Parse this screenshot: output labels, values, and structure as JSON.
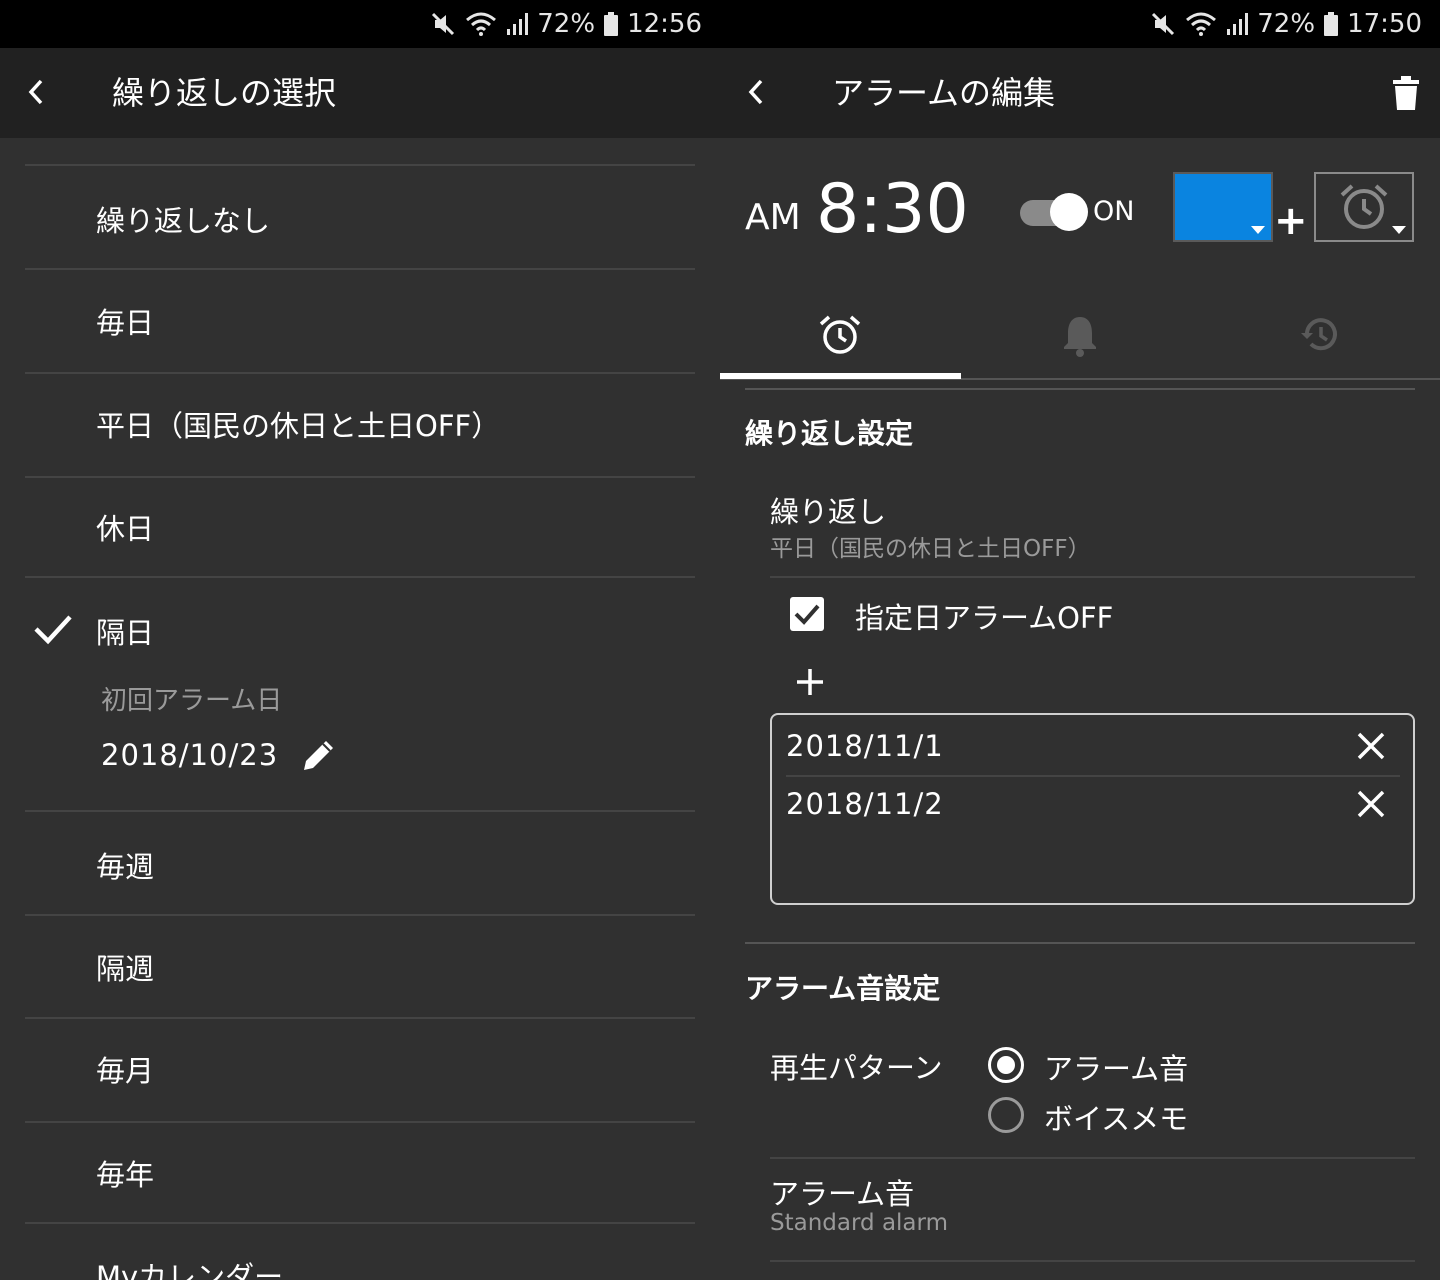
{
  "left": {
    "status": {
      "battery": "72%",
      "time": "12:56"
    },
    "header": {
      "title": "繰り返しの選択"
    },
    "options": [
      {
        "label": "繰り返しなし"
      },
      {
        "label": "毎日"
      },
      {
        "label": "平日（国民の休日と土日OFF）"
      },
      {
        "label": "休日"
      },
      {
        "label": "隔日",
        "selected": true
      },
      {
        "label": "毎週"
      },
      {
        "label": "隔週"
      },
      {
        "label": "毎月"
      },
      {
        "label": "毎年"
      },
      {
        "label": "Myカレンダー"
      }
    ],
    "first_alarm": {
      "label": "初回アラーム日",
      "date": "2018/10/23"
    }
  },
  "right": {
    "status": {
      "battery": "72%",
      "time": "17:50"
    },
    "header": {
      "title": "アラームの編集"
    },
    "alarm": {
      "ampm": "AM",
      "time": "8:30",
      "toggle_label": "ON",
      "toggle_on": true,
      "color": "#0a84e0",
      "plus": "+"
    },
    "tabs": [
      {
        "icon": "alarm-clock-icon",
        "selected": true
      },
      {
        "icon": "bell-icon"
      },
      {
        "icon": "history-icon"
      }
    ],
    "repeat_section": {
      "title": "繰り返し設定",
      "repeat_label": "繰り返し",
      "repeat_value": "平日（国民の休日と土日OFF）",
      "exclude_checkbox_label": "指定日アラームOFF",
      "exclude_checked": true,
      "dates": [
        "2018/11/1",
        "2018/11/2"
      ]
    },
    "sound_section": {
      "title": "アラーム音設定",
      "pattern_label": "再生パターン",
      "pattern_options": [
        {
          "label": "アラーム音",
          "selected": true
        },
        {
          "label": "ボイスメモ",
          "selected": false
        }
      ],
      "sound_label": "アラーム音",
      "sound_value": "Standard alarm"
    }
  }
}
